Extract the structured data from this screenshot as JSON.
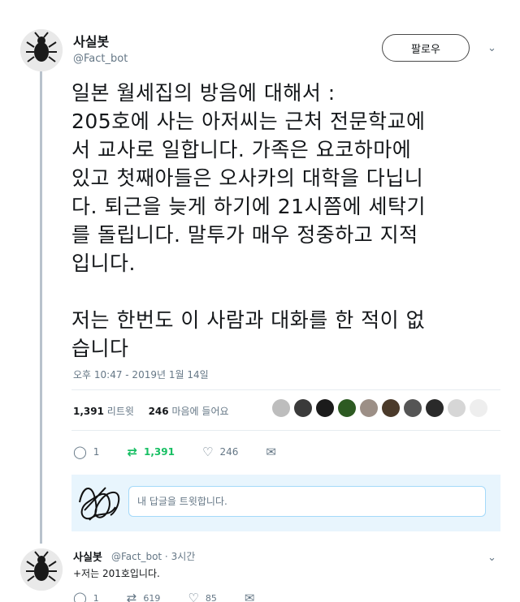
{
  "tweet": {
    "display_name": "사실봇",
    "handle": "@Fact_bot",
    "follow_label": "팔로우",
    "text": "일본 월세집의 방음에 대해서 :\n205호에 사는 아저씨는 근처 전문학교에\n서 교사로 일합니다. 가족은 요코하마에\n있고 첫째아들은 오사카의 대학을 다닙니\n다. 퇴근을 늦게 하기에 21시쯤에 세탁기\n를 돌립니다. 말투가 매우 정중하고 지적\n입니다.\n\n저는 한번도 이 사람과 대화를 한 적이 없\n습니다",
    "timestamp": "오후 10:47 - 2019년 1월 14일",
    "retweet_count": "1,391",
    "retweet_label": "리트윗",
    "like_count": "246",
    "like_label": "마음에 들어요",
    "reply_count": "1",
    "rt_action_count": "1,391",
    "like_action_count": "246"
  },
  "reply_box": {
    "placeholder": "내 답글을 트윗합니다."
  },
  "reply": {
    "display_name": "사실봇",
    "meta": "@Fact_bot · 3시간",
    "text": "+저는 201호입니다.",
    "reply_count": "1",
    "retweet_count": "619",
    "like_count": "85"
  },
  "icons": {
    "reply": "reply-icon",
    "retweet": "retweet-icon",
    "like": "heart-icon",
    "message": "message-icon",
    "chevron": "chevron-down-icon"
  },
  "colors": {
    "retweet_green": "#17bf63",
    "meta_gray": "#657786",
    "reply_box_bg": "#e8f5fd"
  }
}
